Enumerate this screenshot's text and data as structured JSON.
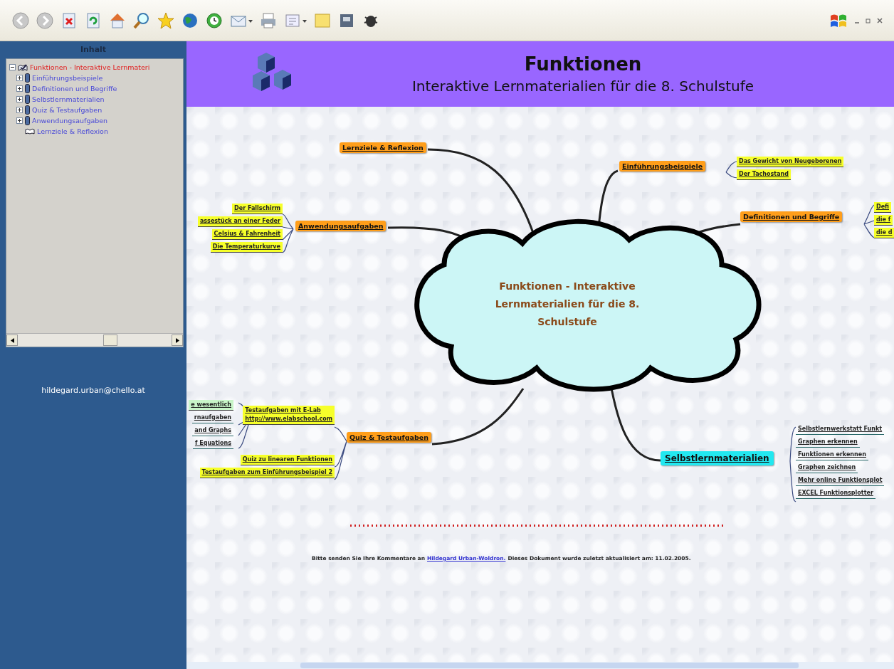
{
  "sidebar": {
    "title": "Inhalt",
    "tree": [
      {
        "label": "Funktionen  - Interaktive Lernmateri",
        "expanded": true,
        "children": [
          {
            "label": "Einführungsbeispiele",
            "expanded": false
          },
          {
            "label": "Definitionen und Begriffe",
            "expanded": false
          },
          {
            "label": "Selbstlernmaterialien",
            "expanded": false
          },
          {
            "label": "Quiz & Testaufgaben",
            "expanded": false
          },
          {
            "label": "Anwendungsaufgaben",
            "expanded": false
          },
          {
            "label": "Lernziele & Reflexion"
          }
        ]
      }
    ],
    "email": "hildegard.urban@chello.at"
  },
  "header": {
    "title": "Funktionen",
    "subtitle": "Interaktive Lernmaterialien für die 8. Schulstufe"
  },
  "mindmap": {
    "center": "Funktionen  - Interaktive Lernmaterialien für die 8. Schulstufe",
    "branches": [
      {
        "label": "Lernziele & Reflexion",
        "kind": "main"
      },
      {
        "label": "Einführungsbeispiele",
        "kind": "main",
        "children": [
          {
            "label": "Das Gewicht von Neugeborenen",
            "kind": "yellow"
          },
          {
            "label": "Der Tachostand",
            "kind": "yellow"
          }
        ]
      },
      {
        "label": "Anwendungsaufgaben",
        "kind": "main",
        "children": [
          {
            "label": "Der Fallschirm",
            "kind": "yellow"
          },
          {
            "label": "assestück an einer Feder",
            "kind": "yellow"
          },
          {
            "label": "Celsius & Fahrenheit",
            "kind": "yellow"
          },
          {
            "label": "Die Temperaturkurve",
            "kind": "yellow"
          }
        ]
      },
      {
        "label": "Definitionen und Begriffe",
        "kind": "main",
        "children": [
          {
            "label": "Defi",
            "kind": "yellow"
          },
          {
            "label": "die f",
            "kind": "yellow"
          },
          {
            "label": "die d",
            "kind": "yellow"
          }
        ]
      },
      {
        "label": "Quiz & Testaufgaben",
        "kind": "main",
        "children": [
          {
            "label": "Testaufgaben mit E-Lab",
            "link": "http://www.elabschool.com",
            "kind": "yellow",
            "children": [
              {
                "label": "e wesentlich",
                "kind": "green"
              },
              {
                "label": "rnaufgaben",
                "kind": "plain"
              },
              {
                "label": "and Graphs",
                "kind": "plain"
              },
              {
                "label": "f Equations",
                "kind": "plain"
              }
            ]
          },
          {
            "label": "Quiz zu linearen Funktionen",
            "kind": "yellow"
          },
          {
            "label": "Testaufgaben zum Einführungsbeispiel 2",
            "kind": "yellow"
          }
        ]
      },
      {
        "label": "Selbstlernmaterialien",
        "kind": "highlight",
        "children": [
          {
            "label": "Selbstlernwerkstatt Funkt",
            "kind": "plain"
          },
          {
            "label": "Graphen erkennen",
            "kind": "plain"
          },
          {
            "label": "Funktionen erkennen",
            "kind": "plain"
          },
          {
            "label": "Graphen zeichnen",
            "kind": "plain"
          },
          {
            "label": "Mehr online Funktionsplot",
            "kind": "plain"
          },
          {
            "label": "EXCEL Funktionsplotter",
            "kind": "plain"
          }
        ]
      }
    ]
  },
  "footer": {
    "before": "Bitte senden Sie Ihre Kommentare an",
    "link": "Hildegard Urban-Woldron.",
    "after": "Dieses Dokument wurde zuletzt aktualisiert am: 11.02.2005."
  }
}
